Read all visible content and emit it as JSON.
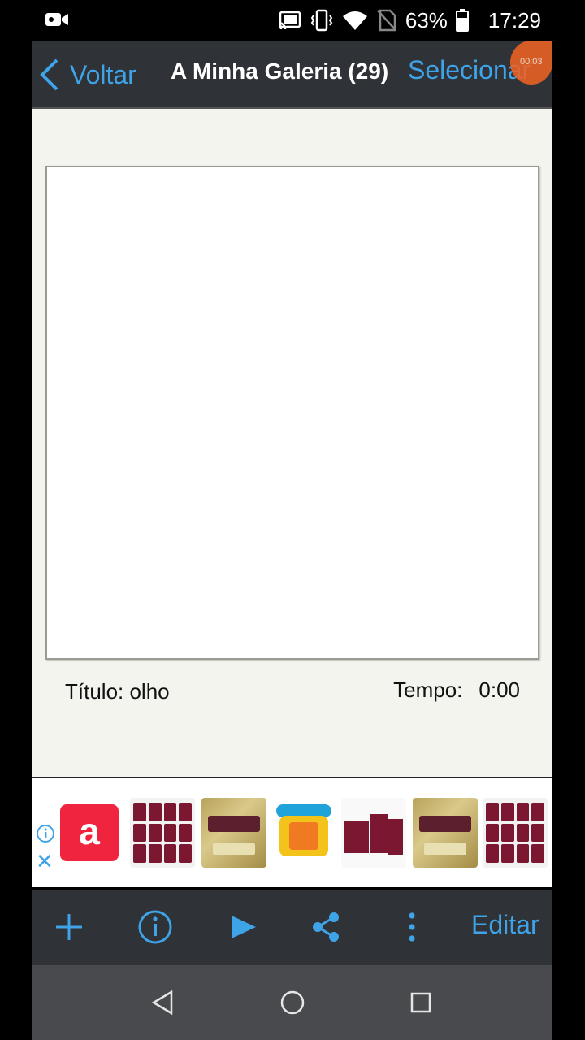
{
  "status_bar": {
    "battery": "63%",
    "time": "17:29",
    "icons": [
      "video-camera-icon",
      "cast-icon",
      "vibrate-icon",
      "wifi-icon",
      "no-sim-icon",
      "battery-icon"
    ]
  },
  "nav": {
    "back_label": "Voltar",
    "title": "A Minha Galeria (29)",
    "select_label": "Selecionar",
    "recording_time": "00:03"
  },
  "detail": {
    "title_label": "Título: olho",
    "time_label": "Tempo:",
    "time_value": "0:00"
  },
  "ad": {
    "logo_text": "a",
    "items": [
      "stickers",
      "album",
      "toy-phone",
      "flag-stickers",
      "album",
      "stickers"
    ]
  },
  "toolbar": {
    "edit_label": "Editar",
    "icons": [
      "plus-icon",
      "info-icon",
      "play-icon",
      "share-icon",
      "more-vertical-icon"
    ]
  },
  "system_nav": [
    "back-triangle-icon",
    "home-circle-icon",
    "recents-square-icon"
  ],
  "colors": {
    "accent": "#3fa3e8",
    "bar": "#2f3237",
    "recording": "#ee6223",
    "ad_logo": "#f0243f"
  }
}
